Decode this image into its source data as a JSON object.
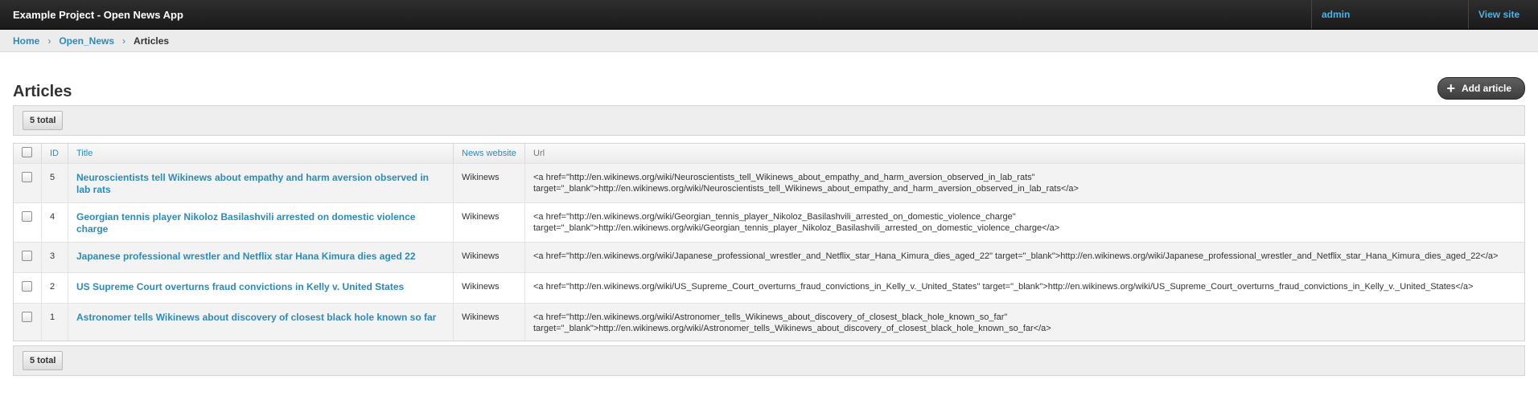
{
  "header": {
    "brand": "Example Project - Open News App",
    "user": "admin",
    "view_site": "View site"
  },
  "breadcrumb": {
    "home": "Home",
    "app": "Open_News",
    "current": "Articles"
  },
  "page": {
    "title": "Articles",
    "add_button": "Add article"
  },
  "actions": {
    "total_top": "5 total",
    "total_bottom": "5 total"
  },
  "table": {
    "columns": [
      "ID",
      "Title",
      "News website",
      "Url"
    ],
    "rows": [
      {
        "id": "5",
        "title": "Neuroscientists tell Wikinews about empathy and harm aversion observed in lab rats",
        "site": "Wikinews",
        "url": "<a href=\"http://en.wikinews.org/wiki/Neuroscientists_tell_Wikinews_about_empathy_and_harm_aversion_observed_in_lab_rats\" target=\"_blank\">http://en.wikinews.org/wiki/Neuroscientists_tell_Wikinews_about_empathy_and_harm_aversion_observed_in_lab_rats</a>"
      },
      {
        "id": "4",
        "title": "Georgian tennis player Nikoloz Basilashvili arrested on domestic violence charge",
        "site": "Wikinews",
        "url": "<a href=\"http://en.wikinews.org/wiki/Georgian_tennis_player_Nikoloz_Basilashvili_arrested_on_domestic_violence_charge\" target=\"_blank\">http://en.wikinews.org/wiki/Georgian_tennis_player_Nikoloz_Basilashvili_arrested_on_domestic_violence_charge</a>"
      },
      {
        "id": "3",
        "title": "Japanese professional wrestler and Netflix star Hana Kimura dies aged 22",
        "site": "Wikinews",
        "url": "<a href=\"http://en.wikinews.org/wiki/Japanese_professional_wrestler_and_Netflix_star_Hana_Kimura_dies_aged_22\" target=\"_blank\">http://en.wikinews.org/wiki/Japanese_professional_wrestler_and_Netflix_star_Hana_Kimura_dies_aged_22</a>"
      },
      {
        "id": "2",
        "title": "US Supreme Court overturns fraud convictions in Kelly v. United States",
        "site": "Wikinews",
        "url": "<a href=\"http://en.wikinews.org/wiki/US_Supreme_Court_overturns_fraud_convictions_in_Kelly_v._United_States\" target=\"_blank\">http://en.wikinews.org/wiki/US_Supreme_Court_overturns_fraud_convictions_in_Kelly_v._United_States</a>"
      },
      {
        "id": "1",
        "title": "Astronomer tells Wikinews about discovery of closest black hole known so far",
        "site": "Wikinews",
        "url": "<a href=\"http://en.wikinews.org/wiki/Astronomer_tells_Wikinews_about_discovery_of_closest_black_hole_known_so_far\" target=\"_blank\">http://en.wikinews.org/wiki/Astronomer_tells_Wikinews_about_discovery_of_closest_black_hole_known_so_far</a>"
      }
    ]
  },
  "icons": {
    "breadcrumb_separator": "chevron-right-icon",
    "add": "plus-icon"
  }
}
